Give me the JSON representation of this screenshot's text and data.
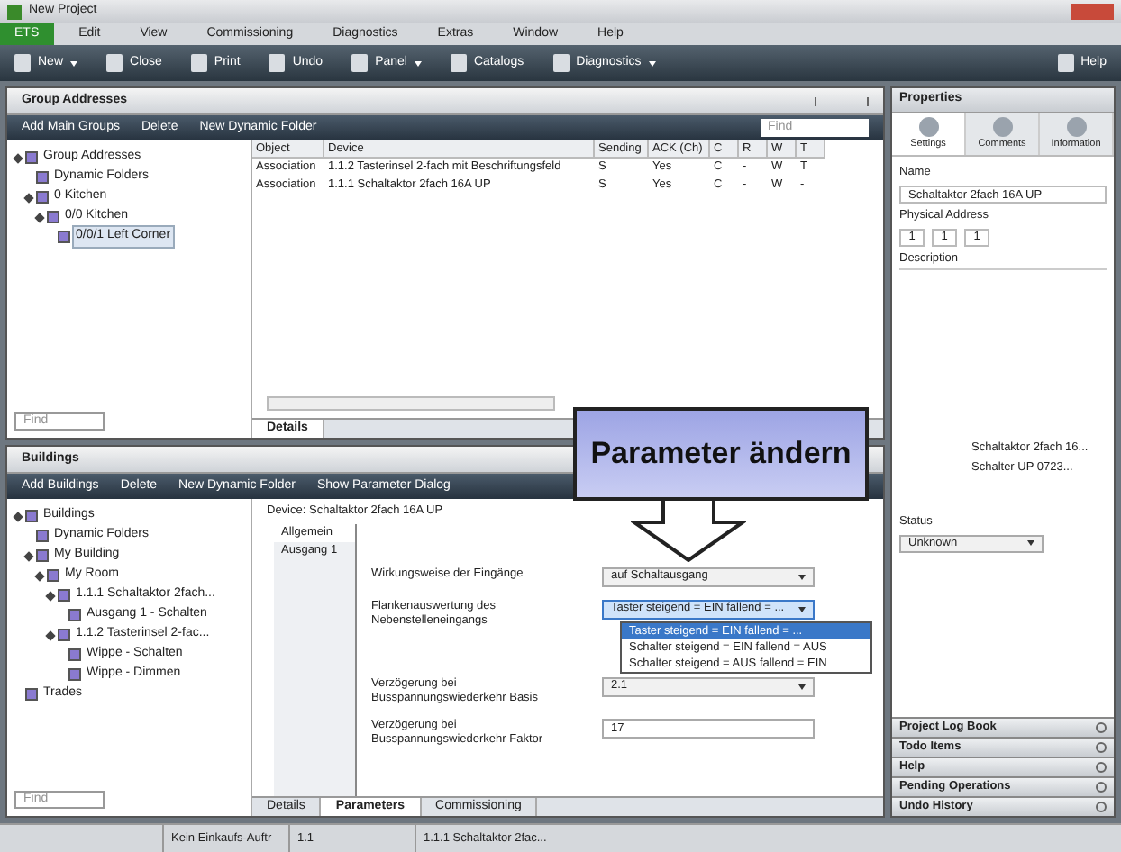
{
  "window": {
    "title": "New Project"
  },
  "menu": [
    {
      "label": "ETS",
      "selected": true
    },
    {
      "label": "Edit",
      "selected": false
    },
    {
      "label": "View",
      "selected": false
    },
    {
      "label": "Commissioning",
      "selected": false
    },
    {
      "label": "Diagnostics",
      "selected": false
    },
    {
      "label": "Extras",
      "selected": false
    },
    {
      "label": "Window",
      "selected": false
    },
    {
      "label": "Help",
      "selected": false
    }
  ],
  "toolbar": [
    {
      "label": "New",
      "kind": "dropdown"
    },
    {
      "label": "Close",
      "kind": "button"
    },
    {
      "label": "Print",
      "kind": "button"
    },
    {
      "label": "Undo",
      "kind": "button"
    },
    {
      "label": "Panel",
      "kind": "dropdown"
    },
    {
      "label": "Catalogs",
      "kind": "button"
    },
    {
      "label": "Diagnostics",
      "kind": "dropdown"
    },
    {
      "label": "Help",
      "kind": "button"
    }
  ],
  "group_addresses": {
    "title": "Group Addresses",
    "toolbar": [
      "Add Main Groups",
      "Delete",
      "New Dynamic Folder"
    ],
    "search": {
      "placeholder": "Find"
    },
    "tree_search": {
      "placeholder": "Find"
    },
    "tree": [
      {
        "label": "Group Addresses",
        "expanded": true,
        "selected": false,
        "children": [
          {
            "label": "Dynamic Folders",
            "selected": false
          },
          {
            "label": "0 Kitchen",
            "expanded": true,
            "selected": false,
            "children": [
              {
                "label": "0/0 Kitchen",
                "expanded": true,
                "selected": false,
                "children": [
                  {
                    "label": "0/0/1 Left Corner",
                    "selected": true
                  }
                ]
              }
            ]
          }
        ]
      }
    ],
    "table": {
      "columns": [
        "Object",
        "Device",
        "Sending",
        "ACK (Ch)",
        "C",
        "R",
        "W",
        "T"
      ],
      "rows": [
        [
          "Association",
          "1.1.2 Tasterinsel 2-fach mit Beschriftungsfeld",
          "S",
          "Yes",
          "C",
          "-",
          "W",
          "T"
        ],
        [
          "Association",
          "1.1.1 Schaltaktor 2fach 16A UP",
          "S",
          "Yes",
          "C",
          "-",
          "W",
          "-"
        ]
      ]
    },
    "tabs": [
      {
        "label": "Details",
        "selected": true
      }
    ]
  },
  "buildings": {
    "title": "Buildings",
    "toolbar": [
      "Add Buildings",
      "Delete",
      "New Dynamic Folder",
      "Show Parameter Dialog"
    ],
    "search": {
      "placeholder": "Find"
    },
    "tree": [
      {
        "label": "Buildings",
        "expanded": true,
        "selected": false,
        "children": [
          {
            "label": "Dynamic Folders",
            "selected": false
          },
          {
            "label": "My Building",
            "expanded": true,
            "selected": false,
            "children": [
              {
                "label": "My Room",
                "expanded": true,
                "selected": false,
                "children": [
                  {
                    "label": "1.1.1 Schaltaktor 2fach...",
                    "expanded": true,
                    "selected": false,
                    "children": [
                      {
                        "label": "Ausgang 1 - Schalten",
                        "selected": false
                      }
                    ]
                  },
                  {
                    "label": "1.1.2 Tasterinsel 2-fac...",
                    "expanded": true,
                    "selected": false,
                    "children": [
                      {
                        "label": "Wippe - Schalten",
                        "selected": false
                      },
                      {
                        "label": "Wippe - Dimmen",
                        "selected": false
                      }
                    ]
                  }
                ]
              }
            ]
          }
        ]
      },
      {
        "label": "Trades",
        "selected": false
      }
    ],
    "parameter": {
      "device": "Device: Schaltaktor 2fach 16A UP",
      "sections": [
        {
          "label": "Allgemein",
          "selected": true
        },
        {
          "label": "Ausgang 1",
          "selected": false
        }
      ],
      "rows": [
        {
          "label": "Wirkungsweise der Eingänge",
          "value": "auf Schaltausgang",
          "kind": "select",
          "open": false
        },
        {
          "label": "Flankenauswertung des Nebenstelleneingangs",
          "value": "Taster steigend = EIN fallend = ...",
          "kind": "select",
          "open": true
        },
        {
          "label": "Verzögerung bei Busspannungswiederkehr Basis",
          "value": "2.1",
          "kind": "select",
          "open": false
        },
        {
          "label": "Verzögerung bei Busspannungswiederkehr Faktor",
          "value": "17",
          "kind": "input",
          "open": false
        }
      ],
      "options": [
        {
          "label": "Taster steigend = EIN fallend = ...",
          "selected": true
        },
        {
          "label": "Schalter steigend = EIN fallend = AUS",
          "selected": false
        },
        {
          "label": "Schalter steigend = AUS fallend = EIN",
          "selected": false
        }
      ]
    },
    "tabs": [
      {
        "label": "Details",
        "selected": false
      },
      {
        "label": "Parameters",
        "selected": true
      },
      {
        "label": "Commissioning",
        "selected": false
      }
    ]
  },
  "callout": {
    "text": "Parameter ändern"
  },
  "properties": {
    "title": "Properties",
    "tabs": [
      {
        "label": "Settings",
        "selected": true
      },
      {
        "label": "Comments",
        "selected": false
      },
      {
        "label": "Information",
        "selected": false
      }
    ],
    "name_label": "Name",
    "name": "Schaltaktor 2fach 16A UP",
    "address_label": "Physical Address",
    "address": [
      "1",
      "1",
      "1"
    ],
    "description_label": "Description",
    "info": [
      "Schaltaktor 2fach 16...",
      "Schalter UP 0723..."
    ],
    "status_label": "Status",
    "status": "Unknown",
    "sections": [
      "Project Log Book",
      "Todo Items",
      "Help",
      "Pending Operations",
      "Undo History"
    ]
  },
  "status_bar": [
    "Kein Einkaufs-Auftr",
    "1.1",
    "1.1.1 Schaltaktor 2fac..."
  ]
}
